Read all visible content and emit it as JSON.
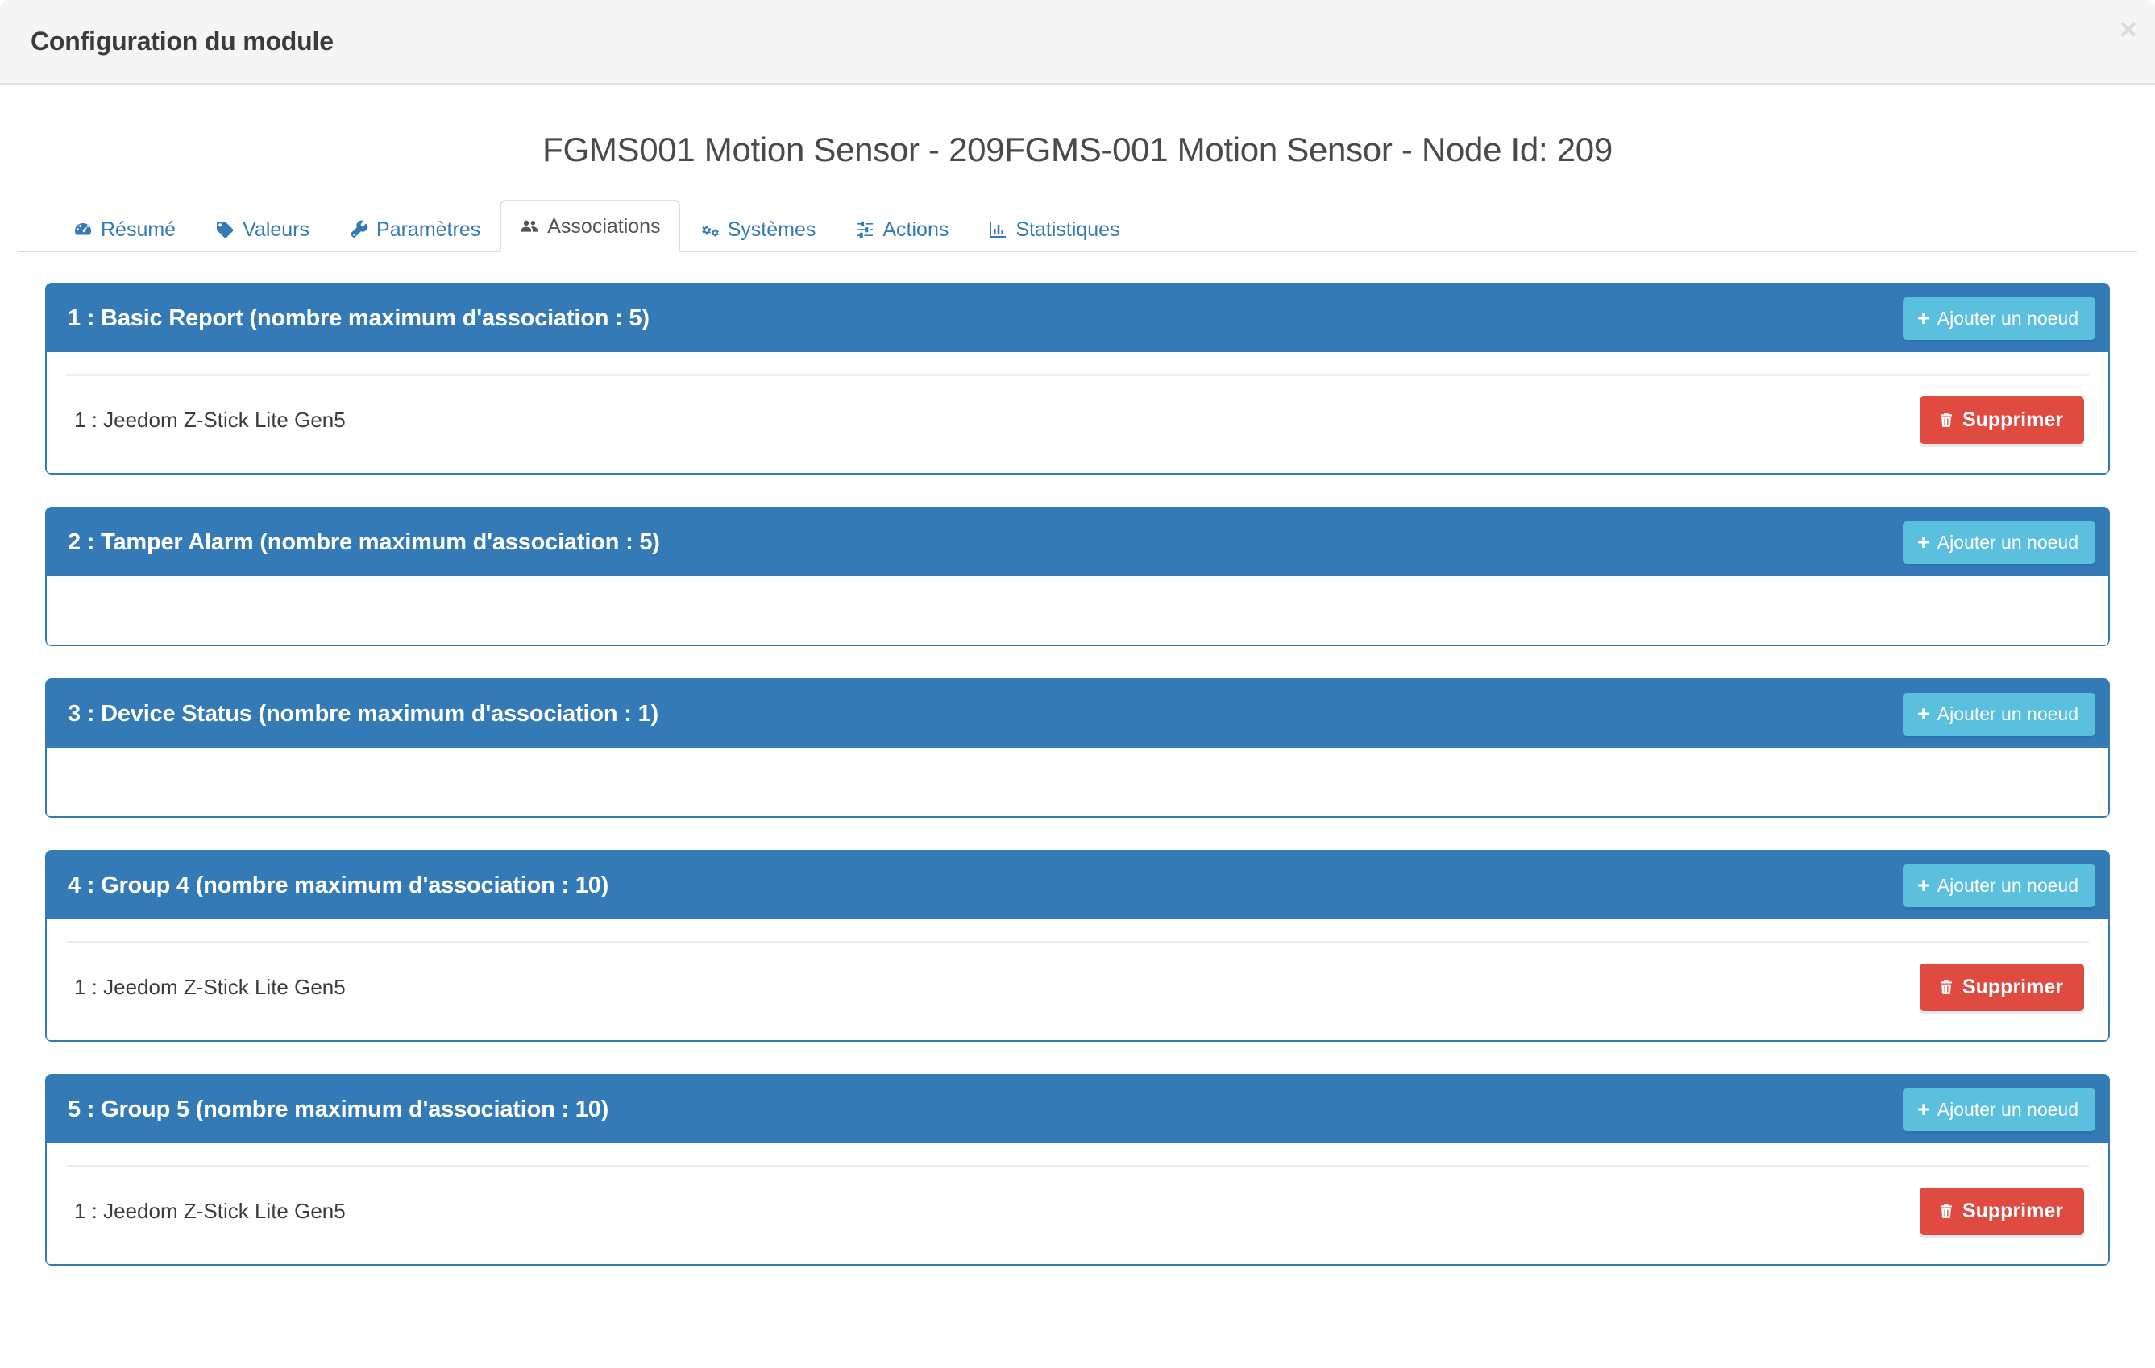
{
  "modal": {
    "title": "Configuration du module",
    "close_label": "×"
  },
  "device": {
    "title": "FGMS001 Motion Sensor - 209FGMS-001 Motion Sensor - Node Id: 209"
  },
  "tabs": [
    {
      "label": "Résumé",
      "icon": "tachometer-icon",
      "active": false
    },
    {
      "label": "Valeurs",
      "icon": "tag-icon",
      "active": false
    },
    {
      "label": "Paramètres",
      "icon": "wrench-icon",
      "active": false
    },
    {
      "label": "Associations",
      "icon": "users-icon",
      "active": true
    },
    {
      "label": "Systèmes",
      "icon": "cogs-icon",
      "active": false
    },
    {
      "label": "Actions",
      "icon": "sliders-icon",
      "active": false
    },
    {
      "label": "Statistiques",
      "icon": "bar-chart-icon",
      "active": false
    }
  ],
  "buttons": {
    "add_node": "Ajouter un noeud",
    "delete": "Supprimer",
    "add_icon": "plus-icon",
    "delete_icon": "trash-icon"
  },
  "groups": [
    {
      "heading": "1 : Basic Report (nombre maximum d'association : 5)",
      "nodes": [
        {
          "label": "1 : Jeedom Z-Stick Lite Gen5"
        }
      ]
    },
    {
      "heading": "2 : Tamper Alarm (nombre maximum d'association : 5)",
      "nodes": []
    },
    {
      "heading": "3 : Device Status (nombre maximum d'association : 1)",
      "nodes": []
    },
    {
      "heading": "4 : Group 4 (nombre maximum d'association : 10)",
      "nodes": [
        {
          "label": "1 : Jeedom Z-Stick Lite Gen5"
        }
      ]
    },
    {
      "heading": "5 : Group 5 (nombre maximum d'association : 10)",
      "nodes": [
        {
          "label": "1 : Jeedom Z-Stick Lite Gen5"
        }
      ]
    }
  ],
  "colors": {
    "panel_blue": "#337ab7",
    "info_blue": "#5bc0de",
    "danger_red": "#e04b41",
    "header_gray": "#f5f5f5",
    "link_blue": "#337ab7"
  }
}
